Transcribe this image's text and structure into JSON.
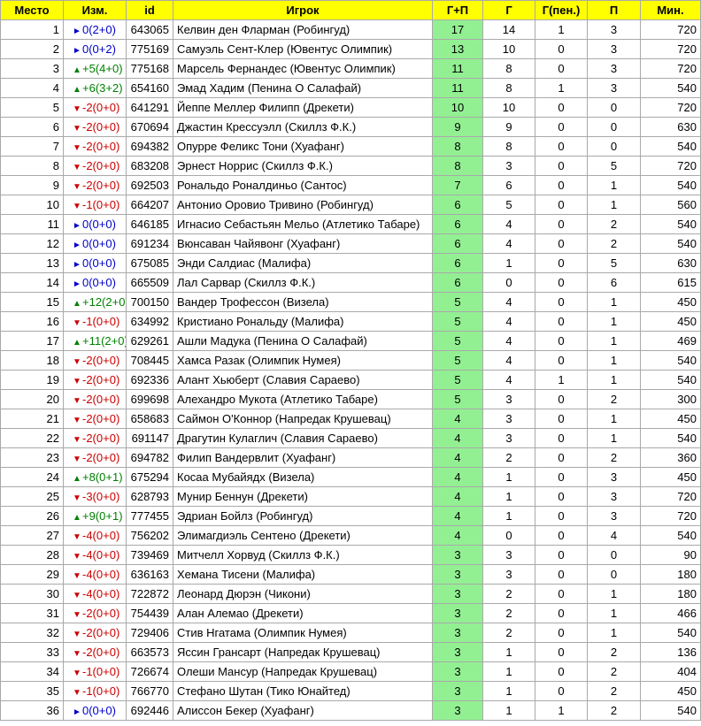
{
  "headers": {
    "place": "Место",
    "change": "Изм.",
    "id": "id",
    "player": "Игрок",
    "gp": "Г+П",
    "g": "Г",
    "gpen": "Г(пен.)",
    "p": "П",
    "min": "Мин."
  },
  "colors": {
    "header_bg": "#ffff00",
    "gp_bg": "#92f092",
    "up": "#008000",
    "down": "#cc0000",
    "same": "#0000cc"
  },
  "rows": [
    {
      "place": "1",
      "dir": "same",
      "icon": "►",
      "change": "0(2+0)",
      "id": "643065",
      "player": "Келвин ден Фларман (Робингуд)",
      "gp": "17",
      "g": "14",
      "gpen": "1",
      "p": "3",
      "min": "720"
    },
    {
      "place": "2",
      "dir": "same",
      "icon": "►",
      "change": "0(0+2)",
      "id": "775169",
      "player": "Самуэль Сент-Клер (Ювентус Олимпик)",
      "gp": "13",
      "g": "10",
      "gpen": "0",
      "p": "3",
      "min": "720"
    },
    {
      "place": "3",
      "dir": "up",
      "icon": "▲",
      "change": "+5(4+0)",
      "id": "775168",
      "player": "Марсель Фернандес (Ювентус Олимпик)",
      "gp": "11",
      "g": "8",
      "gpen": "0",
      "p": "3",
      "min": "720"
    },
    {
      "place": "4",
      "dir": "up",
      "icon": "▲",
      "change": "+6(3+2)",
      "id": "654160",
      "player": "Эмад Хадим (Пенина О Салафай)",
      "gp": "11",
      "g": "8",
      "gpen": "1",
      "p": "3",
      "min": "540"
    },
    {
      "place": "5",
      "dir": "down",
      "icon": "▼",
      "change": "-2(0+0)",
      "id": "641291",
      "player": "Йеппе Меллер Филипп (Дрекети)",
      "gp": "10",
      "g": "10",
      "gpen": "0",
      "p": "0",
      "min": "720"
    },
    {
      "place": "6",
      "dir": "down",
      "icon": "▼",
      "change": "-2(0+0)",
      "id": "670694",
      "player": "Джастин Крессуэлл (Скиллз Ф.К.)",
      "gp": "9",
      "g": "9",
      "gpen": "0",
      "p": "0",
      "min": "630"
    },
    {
      "place": "7",
      "dir": "down",
      "icon": "▼",
      "change": "-2(0+0)",
      "id": "694382",
      "player": "Опурре Феликс Тони (Хуафанг)",
      "gp": "8",
      "g": "8",
      "gpen": "0",
      "p": "0",
      "min": "540"
    },
    {
      "place": "8",
      "dir": "down",
      "icon": "▼",
      "change": "-2(0+0)",
      "id": "683208",
      "player": "Эрнест Норрис (Скиллз Ф.К.)",
      "gp": "8",
      "g": "3",
      "gpen": "0",
      "p": "5",
      "min": "720"
    },
    {
      "place": "9",
      "dir": "down",
      "icon": "▼",
      "change": "-2(0+0)",
      "id": "692503",
      "player": "Рональдо Роналдиньо (Сантос)",
      "gp": "7",
      "g": "6",
      "gpen": "0",
      "p": "1",
      "min": "540"
    },
    {
      "place": "10",
      "dir": "down",
      "icon": "▼",
      "change": "-1(0+0)",
      "id": "664207",
      "player": "Антонио Оровио Тривино (Робингуд)",
      "gp": "6",
      "g": "5",
      "gpen": "0",
      "p": "1",
      "min": "560"
    },
    {
      "place": "11",
      "dir": "same",
      "icon": "►",
      "change": "0(0+0)",
      "id": "646185",
      "player": "Игнасио Себастьян Мельо (Атлетико Табаре)",
      "gp": "6",
      "g": "4",
      "gpen": "0",
      "p": "2",
      "min": "540"
    },
    {
      "place": "12",
      "dir": "same",
      "icon": "►",
      "change": "0(0+0)",
      "id": "691234",
      "player": "Вюнсаван Чайявонг (Хуафанг)",
      "gp": "6",
      "g": "4",
      "gpen": "0",
      "p": "2",
      "min": "540"
    },
    {
      "place": "13",
      "dir": "same",
      "icon": "►",
      "change": "0(0+0)",
      "id": "675085",
      "player": "Энди Салдиас (Малифа)",
      "gp": "6",
      "g": "1",
      "gpen": "0",
      "p": "5",
      "min": "630"
    },
    {
      "place": "14",
      "dir": "same",
      "icon": "►",
      "change": "0(0+0)",
      "id": "665509",
      "player": "Лал Сарвар (Скиллз Ф.К.)",
      "gp": "6",
      "g": "0",
      "gpen": "0",
      "p": "6",
      "min": "615"
    },
    {
      "place": "15",
      "dir": "up",
      "icon": "▲",
      "change": "+12(2+0)",
      "id": "700150",
      "player": "Вандер Трофессон (Визела)",
      "gp": "5",
      "g": "4",
      "gpen": "0",
      "p": "1",
      "min": "450"
    },
    {
      "place": "16",
      "dir": "down",
      "icon": "▼",
      "change": "-1(0+0)",
      "id": "634992",
      "player": "Кристиано Рональду (Малифа)",
      "gp": "5",
      "g": "4",
      "gpen": "0",
      "p": "1",
      "min": "450"
    },
    {
      "place": "17",
      "dir": "up",
      "icon": "▲",
      "change": "+11(2+0)",
      "id": "629261",
      "player": "Ашли Мадука (Пенина О Салафай)",
      "gp": "5",
      "g": "4",
      "gpen": "0",
      "p": "1",
      "min": "469"
    },
    {
      "place": "18",
      "dir": "down",
      "icon": "▼",
      "change": "-2(0+0)",
      "id": "708445",
      "player": "Хамса Разак (Олимпик Нумея)",
      "gp": "5",
      "g": "4",
      "gpen": "0",
      "p": "1",
      "min": "540"
    },
    {
      "place": "19",
      "dir": "down",
      "icon": "▼",
      "change": "-2(0+0)",
      "id": "692336",
      "player": "Алант Хьюберт (Славия Сараево)",
      "gp": "5",
      "g": "4",
      "gpen": "1",
      "p": "1",
      "min": "540"
    },
    {
      "place": "20",
      "dir": "down",
      "icon": "▼",
      "change": "-2(0+0)",
      "id": "699698",
      "player": "Алехандро Мукота (Атлетико Табаре)",
      "gp": "5",
      "g": "3",
      "gpen": "0",
      "p": "2",
      "min": "300"
    },
    {
      "place": "21",
      "dir": "down",
      "icon": "▼",
      "change": "-2(0+0)",
      "id": "658683",
      "player": "Саймон О'Коннор (Напредак Крушевац)",
      "gp": "4",
      "g": "3",
      "gpen": "0",
      "p": "1",
      "min": "450"
    },
    {
      "place": "22",
      "dir": "down",
      "icon": "▼",
      "change": "-2(0+0)",
      "id": "691147",
      "player": "Драгутин Кулаглич (Славия Сараево)",
      "gp": "4",
      "g": "3",
      "gpen": "0",
      "p": "1",
      "min": "540"
    },
    {
      "place": "23",
      "dir": "down",
      "icon": "▼",
      "change": "-2(0+0)",
      "id": "694782",
      "player": "Филип Вандервлит (Хуафанг)",
      "gp": "4",
      "g": "2",
      "gpen": "0",
      "p": "2",
      "min": "360"
    },
    {
      "place": "24",
      "dir": "up",
      "icon": "▲",
      "change": "+8(0+1)",
      "id": "675294",
      "player": "Косаа Мубайядх (Визела)",
      "gp": "4",
      "g": "1",
      "gpen": "0",
      "p": "3",
      "min": "450"
    },
    {
      "place": "25",
      "dir": "down",
      "icon": "▼",
      "change": "-3(0+0)",
      "id": "628793",
      "player": "Мунир Беннун (Дрекети)",
      "gp": "4",
      "g": "1",
      "gpen": "0",
      "p": "3",
      "min": "720"
    },
    {
      "place": "26",
      "dir": "up",
      "icon": "▲",
      "change": "+9(0+1)",
      "id": "777455",
      "player": "Эдриан Бойлз (Робингуд)",
      "gp": "4",
      "g": "1",
      "gpen": "0",
      "p": "3",
      "min": "720"
    },
    {
      "place": "27",
      "dir": "down",
      "icon": "▼",
      "change": "-4(0+0)",
      "id": "756202",
      "player": "Элимагдиэль Сентено (Дрекети)",
      "gp": "4",
      "g": "0",
      "gpen": "0",
      "p": "4",
      "min": "540"
    },
    {
      "place": "28",
      "dir": "down",
      "icon": "▼",
      "change": "-4(0+0)",
      "id": "739469",
      "player": "Митчелл Хорвуд (Скиллз Ф.К.)",
      "gp": "3",
      "g": "3",
      "gpen": "0",
      "p": "0",
      "min": "90"
    },
    {
      "place": "29",
      "dir": "down",
      "icon": "▼",
      "change": "-4(0+0)",
      "id": "636163",
      "player": "Хемана Тисени (Малифа)",
      "gp": "3",
      "g": "3",
      "gpen": "0",
      "p": "0",
      "min": "180"
    },
    {
      "place": "30",
      "dir": "down",
      "icon": "▼",
      "change": "-4(0+0)",
      "id": "722872",
      "player": "Леонард Дюрэн (Чикони)",
      "gp": "3",
      "g": "2",
      "gpen": "0",
      "p": "1",
      "min": "180"
    },
    {
      "place": "31",
      "dir": "down",
      "icon": "▼",
      "change": "-2(0+0)",
      "id": "754439",
      "player": "Алан Алемао (Дрекети)",
      "gp": "3",
      "g": "2",
      "gpen": "0",
      "p": "1",
      "min": "466"
    },
    {
      "place": "32",
      "dir": "down",
      "icon": "▼",
      "change": "-2(0+0)",
      "id": "729406",
      "player": "Стив Нгатама (Олимпик Нумея)",
      "gp": "3",
      "g": "2",
      "gpen": "0",
      "p": "1",
      "min": "540"
    },
    {
      "place": "33",
      "dir": "down",
      "icon": "▼",
      "change": "-2(0+0)",
      "id": "663573",
      "player": "Яссин Грансарт (Напредак Крушевац)",
      "gp": "3",
      "g": "1",
      "gpen": "0",
      "p": "2",
      "min": "136"
    },
    {
      "place": "34",
      "dir": "down",
      "icon": "▼",
      "change": "-1(0+0)",
      "id": "726674",
      "player": "Олеши Мансур (Напредак Крушевац)",
      "gp": "3",
      "g": "1",
      "gpen": "0",
      "p": "2",
      "min": "404"
    },
    {
      "place": "35",
      "dir": "down",
      "icon": "▼",
      "change": "-1(0+0)",
      "id": "766770",
      "player": "Стефано Шутан (Тико Юнайтед)",
      "gp": "3",
      "g": "1",
      "gpen": "0",
      "p": "2",
      "min": "450"
    },
    {
      "place": "36",
      "dir": "same",
      "icon": "►",
      "change": "0(0+0)",
      "id": "692446",
      "player": "Алиссон Бекер (Хуафанг)",
      "gp": "3",
      "g": "1",
      "gpen": "1",
      "p": "2",
      "min": "540"
    }
  ]
}
